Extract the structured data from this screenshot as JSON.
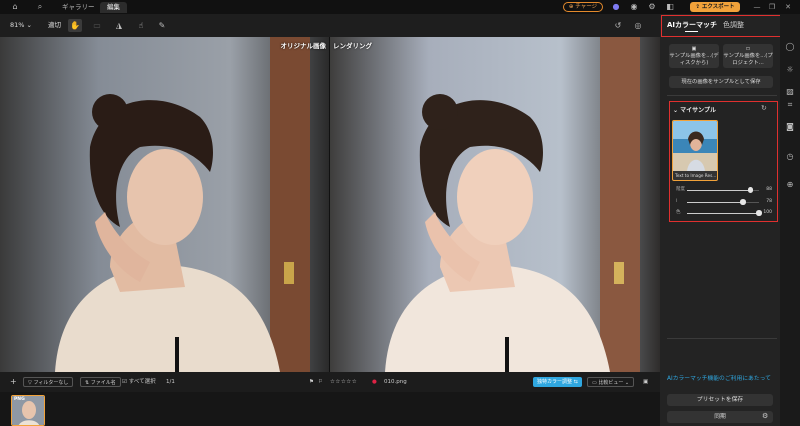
{
  "topbar": {
    "tabs": [
      {
        "label": "ギャラリー"
      },
      {
        "label": "編集"
      }
    ],
    "charge_label": "チャージ",
    "export_label": "エクスポート"
  },
  "toolbar": {
    "zoom": "81%",
    "fit_label": "適切"
  },
  "canvas": {
    "original_label": "オリジナル画像",
    "render_label": "レンダリング"
  },
  "bottombar": {
    "filter_label": "フィルターなし",
    "filename_label": "ファイル名",
    "select_all_label": "すべて選択",
    "page_count": "1/1",
    "rating_stars": "☆☆☆☆☆",
    "file_name": "010.png",
    "compare_color_label": "独特カラー調整",
    "compare_view_label": "比較ビュー",
    "thumb_badge": "PNG"
  },
  "panel": {
    "tabs": [
      {
        "label": "AIカラーマッチ"
      },
      {
        "label": "色調整"
      }
    ],
    "sample_from_disk": "サンプル画像を...(ディスクから)",
    "sample_from_project": "サンプル画像を...(プロジェクト...",
    "save_as_sample": "現在の画像をサンプルとして保存",
    "my_samples_title": "マイサンプル",
    "sample_caption": "Text to Image Res...",
    "sliders": [
      {
        "label": "階度",
        "value": 88
      },
      {
        "label": "l",
        "value": 78
      },
      {
        "label": "色",
        "value": 100
      }
    ],
    "info_link": "AIカラーマッチ機能のご利用にあたって",
    "save_preset_label": "プリセットを保存",
    "sync_label": "同期"
  },
  "colors": {
    "accent": "#2fa7e0",
    "highlight": "#e0302f",
    "export": "#f1a23a"
  }
}
